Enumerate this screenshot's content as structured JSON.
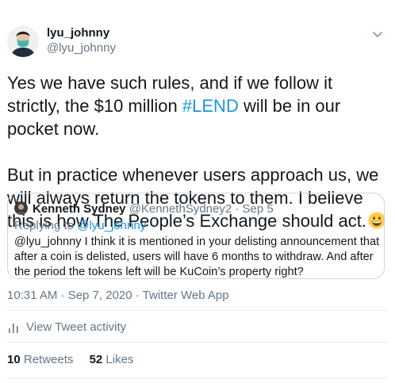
{
  "author": {
    "display_name": "lyu_johnny",
    "handle": "@lyu_johnny"
  },
  "tweet": {
    "line_a": "Yes we have such rules, and if we follow it strictly, the $10 million ",
    "hashtag": "#LEND",
    "line_b": " will be in our pocket now.",
    "para2": "But in practice whenever users approach us, we will always return the tokens to them. I believe this is how The People’s Exchange should act.",
    "emoji": "grinning-face-emoji"
  },
  "quote": {
    "display_name": "Kenneth Sydney",
    "meta": "@KennethSydney2 · Sep 5",
    "replying_prefix": "Replying to ",
    "replying_to": "@lyu_johnny",
    "text": "@lyu_johnny I think it is mentioned in your delisting announcement that after a coin is delisted, users will have 6 months to withdraw. And after the period the tokens left will be KuCoin’s property right?"
  },
  "timestamp": "10:31 AM · Sep 7, 2020 · Twitter Web App",
  "activity_label": "View Tweet activity",
  "stats": {
    "retweets_count": "10",
    "retweets_label": "Retweets",
    "likes_count": "52",
    "likes_label": "Likes"
  },
  "colors": {
    "link": "#1b95e0",
    "secondary_text": "#657786",
    "border": "#ccd6dd"
  }
}
